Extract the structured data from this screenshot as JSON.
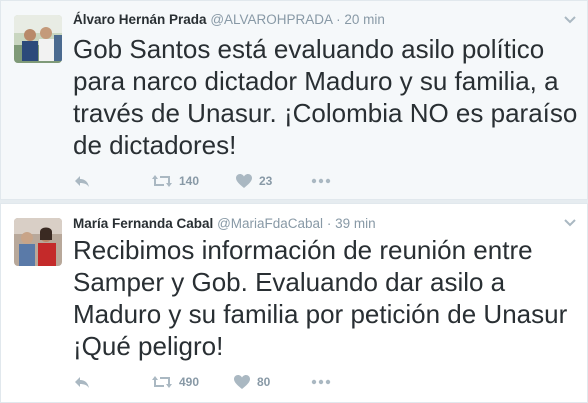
{
  "tweets": [
    {
      "name": "Álvaro Hernán Prada",
      "handle": "@ALVAROHPRADA",
      "separator": "·",
      "time": "20 min",
      "text": "Gob Santos está evaluando asilo político para narco dictador Maduro y su familia, a través de Unasur. ¡Colombia NO es paraíso de dictadores!",
      "retweets": "140",
      "likes": "23",
      "icons": {
        "reply": "reply-icon",
        "retweet": "retweet-icon",
        "like": "heart-icon",
        "more": "more-dots-icon"
      }
    },
    {
      "name": "María Fernanda Cabal",
      "handle": "@MariaFdaCabal",
      "separator": "·",
      "time": "39 min",
      "text": "Recibimos información de reunión entre Samper y Gob. Evaluando dar asilo a Maduro y su familia por petición de Unasur ¡Qué peligro!",
      "retweets": "490",
      "likes": "80",
      "icons": {
        "reply": "reply-icon",
        "retweet": "retweet-icon",
        "like": "heart-icon",
        "more": "more-dots-icon"
      }
    }
  ],
  "colors": {
    "text": "#292f33",
    "muted": "#8899a6",
    "icon": "#aab8c2",
    "border": "#e1e8ed"
  }
}
